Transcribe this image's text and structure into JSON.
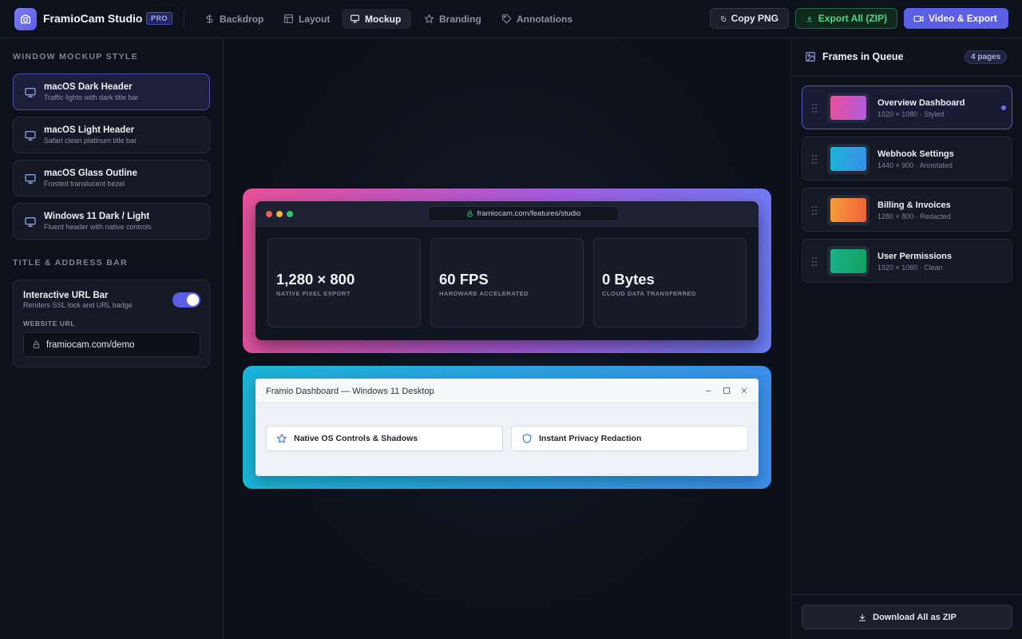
{
  "app": {
    "name": "FramioCam Studio",
    "badge": "PRO"
  },
  "nav_tabs": [
    {
      "label": "Backdrop",
      "icon": "dollar-icon"
    },
    {
      "label": "Layout",
      "icon": "layout-icon"
    },
    {
      "label": "Mockup",
      "icon": "monitor-icon",
      "active": true
    },
    {
      "label": "Branding",
      "icon": "star-icon"
    },
    {
      "label": "Annotations",
      "icon": "tag-icon"
    }
  ],
  "actions": {
    "copy_png": "Copy PNG",
    "export_zip": "Export All (ZIP)",
    "video_export": "Video & Export"
  },
  "left_panel": {
    "mockup_section_title": "WINDOW MOCKUP STYLE",
    "mockup_options": [
      {
        "title": "macOS Dark Header",
        "subtitle": "Traffic lights with dark title bar",
        "selected": true
      },
      {
        "title": "macOS Light Header",
        "subtitle": "Safari clean platinum title bar"
      },
      {
        "title": "macOS Glass Outline",
        "subtitle": "Frosted translucent bezel"
      },
      {
        "title": "Windows 11 Dark / Light",
        "subtitle": "Fluent header with native controls"
      }
    ],
    "address_section_title": "TITLE & ADDRESS BAR",
    "url_bar": {
      "title": "Interactive URL Bar",
      "subtitle": "Renders SSL lock and URL badge",
      "enabled": true,
      "field_label": "WEBSITE URL",
      "value": "framiocam.com/demo"
    }
  },
  "preview": {
    "mac_window": {
      "url": "framiocam.com/features/studio",
      "stats": [
        {
          "value": "1,280 × 800",
          "caption": "NATIVE PIXEL EXPORT"
        },
        {
          "value": "60 FPS",
          "caption": "HARDWARE ACCELERATED"
        },
        {
          "value": "0 Bytes",
          "caption": "CLOUD DATA TRANSFERRED"
        }
      ]
    },
    "win_window": {
      "title": "Framio Dashboard — Windows 11 Desktop",
      "features": [
        {
          "label": "Native OS Controls & Shadows",
          "icon": "star-icon"
        },
        {
          "label": "Instant Privacy Redaction",
          "icon": "shield-icon"
        }
      ]
    }
  },
  "queue": {
    "title": "Frames in Queue",
    "count_badge": "4 pages",
    "items": [
      {
        "name": "Overview Dashboard",
        "meta": "1920 × 1080 · Styled",
        "gradient": [
          "#e8509a",
          "#b25ce0"
        ],
        "selected": true
      },
      {
        "name": "Webhook Settings",
        "meta": "1440 × 900 · Annotated",
        "gradient": [
          "#1ab5d6",
          "#3b8ee8"
        ]
      },
      {
        "name": "Billing & Invoices",
        "meta": "1280 × 800 · Redacted",
        "gradient": [
          "#f59e3a",
          "#f0603a"
        ]
      },
      {
        "name": "User Permissions",
        "meta": "1920 × 1080 · Clean",
        "gradient": [
          "#1bb08a",
          "#12a060"
        ]
      }
    ],
    "download_label": "Download All as ZIP"
  },
  "colors": {
    "accent": "#5b5fe6",
    "success": "#4fd88b",
    "background": "#0c1019"
  }
}
